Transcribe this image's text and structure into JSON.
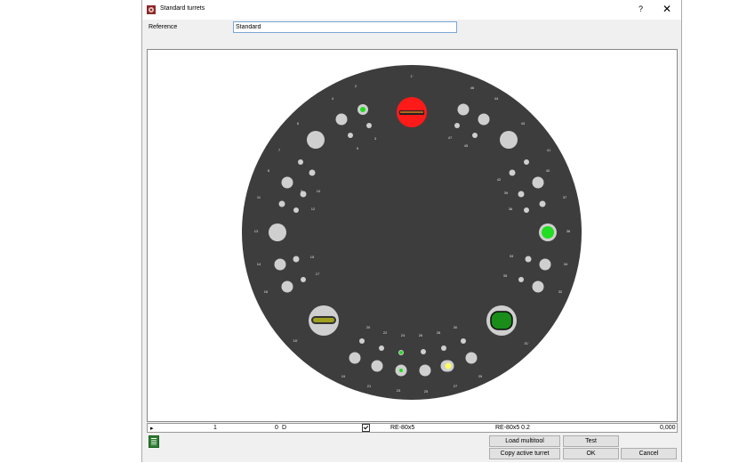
{
  "window": {
    "title": "Standard turrets",
    "help_label": "?",
    "close_label": "✕"
  },
  "form": {
    "reference_label": "Reference",
    "reference_value": "Standard"
  },
  "turret": {
    "background_color": "#3d3d3d",
    "station_labels": [
      "1'",
      "2",
      "3",
      "4",
      "5",
      "6",
      "7",
      "8",
      "9",
      "10",
      "11",
      "12",
      "13",
      "14",
      "15",
      "16",
      "17",
      "18'",
      "19",
      "20",
      "21",
      "22",
      "23",
      "24",
      "25",
      "26",
      "27",
      "28",
      "29",
      "30",
      "31'",
      "32",
      "33",
      "34",
      "35",
      "36",
      "37",
      "38",
      "39",
      "40",
      "41",
      "42",
      "43",
      "44",
      "45",
      "46",
      "47"
    ],
    "active_colors": {
      "red": "#ff1a1a",
      "green": "#22dd22",
      "dark_green": "#1a8c1a",
      "olive": "#a0a020",
      "yellow": "#ffff66"
    }
  },
  "status_row": {
    "arrow": "▸",
    "station": "1",
    "position": "0",
    "orientation": "D",
    "checked": true,
    "tool": "RE-80x5",
    "tool_detail": "RE-80x5 0.2",
    "value": "0,000"
  },
  "buttons": {
    "load_multitool": "Load multitool",
    "test": "Test",
    "copy_active_turret": "Copy active turret",
    "ok": "OK",
    "cancel": "Cancel"
  }
}
